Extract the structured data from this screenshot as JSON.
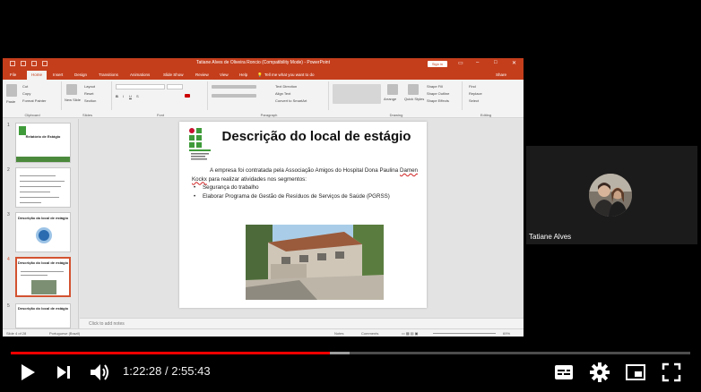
{
  "powerpoint": {
    "window_title": "Tatiane Alves de Oliveira Roncio (Compatibility Mode) - PowerPoint",
    "sign_in": "Sign in",
    "tabs": [
      "File",
      "Home",
      "Insert",
      "Design",
      "Transitions",
      "Animations",
      "Slide Show",
      "Review",
      "View",
      "Help"
    ],
    "tell_me": "Tell me what you want to do",
    "share": "Share",
    "ribbon": {
      "clipboard": {
        "label": "Clipboard",
        "paste": "Paste",
        "cut": "Cut",
        "copy": "Copy",
        "format_painter": "Format Painter"
      },
      "slides": {
        "label": "Slides",
        "new_slide": "New Slide",
        "layout": "Layout",
        "reset": "Reset",
        "section": "Section"
      },
      "font": {
        "label": "Font"
      },
      "paragraph": {
        "label": "Paragraph",
        "text_direction": "Text Direction",
        "align_text": "Align Text",
        "convert_smartart": "Convert to SmartArt"
      },
      "drawing": {
        "label": "Drawing",
        "arrange": "Arrange",
        "quick_styles": "Quick Styles",
        "shape_fill": "Shape Fill",
        "shape_outline": "Shape Outline",
        "shape_effects": "Shape Effects"
      },
      "editing": {
        "label": "Editing",
        "find": "Find",
        "replace": "Replace",
        "select": "Select"
      }
    },
    "thumbnails": [
      {
        "num": "1",
        "title": "Relatório de Estágio"
      },
      {
        "num": "2",
        "title": ""
      },
      {
        "num": "3",
        "title": "Descrição da local de estágio"
      },
      {
        "num": "4",
        "title": "Descrição do local de estágio"
      },
      {
        "num": "5",
        "title": "Descrição do local de estágio"
      }
    ],
    "slide": {
      "title": "Descrição do local de estágio",
      "paragraph_a": "A empresa foi contratada pela Associação Amigos do Hospital Dona Paulina ",
      "paragraph_name": "Damen Kockx",
      "paragraph_b": " para realizar atividades nos segmentos:",
      "bullets": [
        "Segurança do trabalho",
        "Elaborar Programa de Gestão de Resíduos de Serviços de Saúde (PGRSS)"
      ]
    },
    "notes_placeholder": "Click to add notes",
    "status": {
      "slide_of": "Slide 4 of 28",
      "language": "Portuguese (Brazil)",
      "notes": "Notes",
      "comments": "Comments",
      "zoom": "69%"
    }
  },
  "webcam": {
    "name": "Tatiane Alves"
  },
  "player": {
    "current_time": "1:22:28",
    "duration": "2:55:43",
    "progress_fraction": 0.469,
    "buffer_fraction": 0.03,
    "accent_color": "#ff0000"
  }
}
